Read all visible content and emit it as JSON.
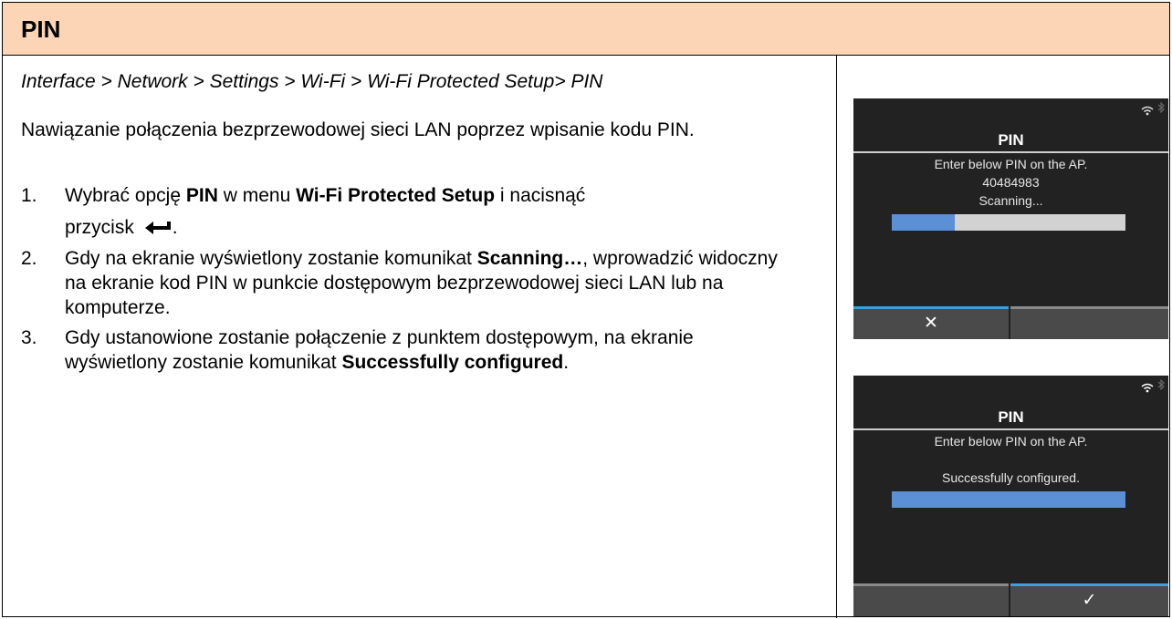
{
  "header": {
    "title": "PIN"
  },
  "breadcrumb": "Interface > Network > Settings > Wi-Fi > Wi-Fi Protected Setup> PIN",
  "intro": "Nawiązanie połączenia bezprzewodowej sieci LAN poprzez wpisanie kodu PIN.",
  "steps": [
    {
      "num": "1.",
      "t1": "Wybrać opcję ",
      "b1": "PIN",
      "t2": " w menu ",
      "b2": "Wi-Fi Protected Setup",
      "t3": " i nacisnąć",
      "t4": "przycisk ",
      "t5": ".",
      "icon": "enter-key-icon"
    },
    {
      "num": "2.",
      "t1": "Gdy na ekranie wyświetlony zostanie komunikat ",
      "b1": "Scanning…",
      "t2": ", wprowadzić widoczny na ekranie kod PIN w punkcie dostępowym bezprzewodowej sieci LAN lub na komputerze."
    },
    {
      "num": "3.",
      "t1": "Gdy ustanowione zostanie połączenie z punktem dostępowym, na ekranie wyświetlony zostanie komunikat ",
      "b1": "Successfully configured",
      "t2": "."
    }
  ],
  "screens": [
    {
      "title": "PIN",
      "line1": "Enter below PIN on the AP.",
      "pin": "40484983",
      "status": "Scanning...",
      "progress": 0.27,
      "left_key": "✕",
      "right_key": "",
      "left_accent": "#3aa0e0",
      "right_accent": "#8a8a8a",
      "icons": [
        "wifi-icon",
        "bluetooth-icon",
        "close-icon"
      ]
    },
    {
      "title": "PIN",
      "line1": "Enter below PIN on the AP.",
      "pin": "",
      "status": "Successfully configured.",
      "progress": 1.0,
      "left_key": "",
      "right_key": "✓",
      "left_accent": "#8a8a8a",
      "right_accent": "#3aa0e0",
      "icons": [
        "wifi-icon",
        "bluetooth-icon",
        "checkmark-icon"
      ]
    }
  ],
  "colors": {
    "header_bg": "#fbd5b5",
    "screen_bg": "#222222",
    "progress_fill": "#5b8fd6",
    "accent": "#3aa0e0"
  }
}
